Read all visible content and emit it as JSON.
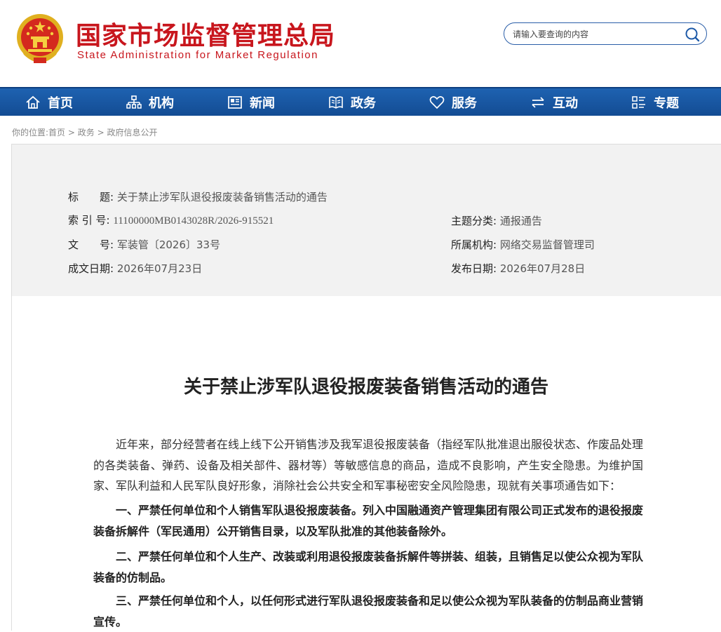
{
  "header": {
    "site_title_cn": "国家市场监督管理总局",
    "site_title_en": "State Administration for Market Regulation",
    "search_placeholder": "请输入要查询的内容",
    "brand_color": "#c8161d"
  },
  "nav": {
    "items": [
      {
        "label": "首页",
        "icon": "home-icon"
      },
      {
        "label": "机构",
        "icon": "org-chart-icon"
      },
      {
        "label": "新闻",
        "icon": "news-icon"
      },
      {
        "label": "政务",
        "icon": "open-book-icon"
      },
      {
        "label": "服务",
        "icon": "heart-icon"
      },
      {
        "label": "互动",
        "icon": "exchange-arrows-icon"
      },
      {
        "label": "专题",
        "icon": "grid-list-icon"
      }
    ],
    "bg_color": "#1b5aa8"
  },
  "breadcrumb": {
    "prefix": "你的位置:",
    "items": [
      "首页",
      "政务",
      "政府信息公开"
    ],
    "separator": " > "
  },
  "meta": {
    "title_label": "标　　题:",
    "title_value": "关于禁止涉军队退役报废装备销售活动的通告",
    "index_label": "索 引 号:",
    "index_value": "11100000MB0143028R/2026-915521",
    "category_label": "主题分类:",
    "category_value": "通报通告",
    "docno_label": "文　　号:",
    "docno_value": "军装管〔2026〕33号",
    "org_label": "所属机构:",
    "org_value": "网络交易监督管理司",
    "written_label": "成文日期:",
    "written_value": "2026年07月23日",
    "published_label": "发布日期:",
    "published_value": "2026年07月28日"
  },
  "article": {
    "title": "关于禁止涉军队退役报废装备销售活动的通告",
    "intro": "近年来，部分经营者在线上线下公开销售涉及我军退役报废装备（指经军队批准退出服役状态、作废品处理的各类装备、弹药、设备及相关部件、器材等）等敏感信息的商品，造成不良影响，产生安全隐患。为维护国家、军队利益和人民军队良好形象，消除社会公共安全和军事秘密安全风险隐患，现就有关事项通告如下：",
    "item1": "一、严禁任何单位和个人销售军队退役报废装备。列入中国融通资产管理集团有限公司正式发布的退役报废装备拆解件（军民通用）公开销售目录，以及军队批准的其他装备除外。",
    "item2": "二、严禁任何单位和个人生产、改装或利用退役报废装备拆解件等拼装、组装，且销售足以使公众视为军队装备的仿制品。",
    "item3": "三、严禁任何单位和个人，以任何形式进行军队退役报废装备和足以使公众视为军队装备的仿制品商业营销宣传。"
  }
}
